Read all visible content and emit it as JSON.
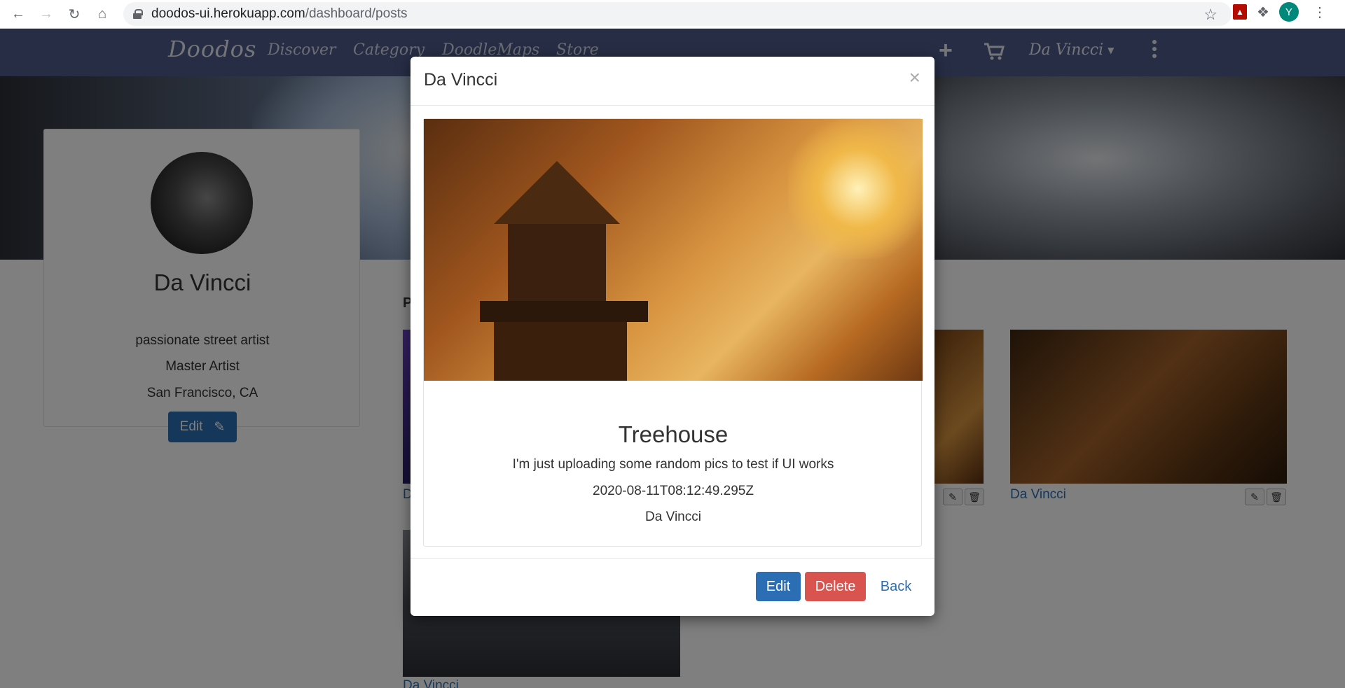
{
  "browser": {
    "url_host": "doodos-ui.herokuapp.com",
    "url_path": "/dashboard/posts",
    "profile_initial": "Y"
  },
  "navbar": {
    "brand": "Doodos",
    "links": [
      "Discover",
      "Category",
      "DoodleMaps",
      "Store"
    ],
    "user_label": "Da Vincci",
    "icons": [
      "plus-icon",
      "cart-icon",
      "caret-down-icon",
      "kebab-menu-icon"
    ]
  },
  "profile": {
    "name": "Da Vincci",
    "bio": "passionate street artist",
    "title": "Master Artist",
    "location": "San Francisco, CA",
    "edit_label": "Edit"
  },
  "posts": {
    "heading": "P",
    "captions": [
      "D",
      "Da Vincci",
      "Da Vincci"
    ]
  },
  "modal": {
    "title": "Da Vincci",
    "close_label": "×",
    "post": {
      "title": "Treehouse",
      "description": "I'm just uploading some random pics to test if UI works",
      "date": "2020-08-11T08:12:49.295Z",
      "author": "Da Vincci"
    },
    "buttons": {
      "edit": "Edit",
      "delete": "Delete",
      "back": "Back"
    }
  },
  "colors": {
    "navbar": "#4e5a8a",
    "primary": "#2b6eb4",
    "danger": "#d9534f"
  }
}
